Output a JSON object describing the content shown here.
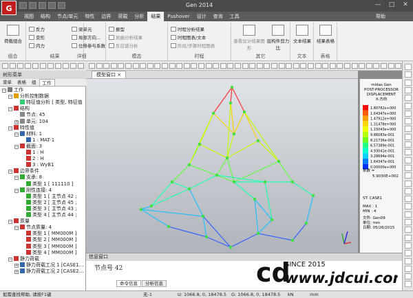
{
  "app": {
    "title": "Gen 2014",
    "logo": "Gen-logo",
    "logo_text": "G"
  },
  "window_controls": {
    "minimize": "—",
    "maximize": "□",
    "close": "✕"
  },
  "menu": {
    "tabs": [
      {
        "label": "视图"
      },
      {
        "label": "结构"
      },
      {
        "label": "节点/单元"
      },
      {
        "label": "特性"
      },
      {
        "label": "边界"
      },
      {
        "label": "荷载"
      },
      {
        "label": "分析"
      },
      {
        "label": "结果"
      },
      {
        "label": "Pushover"
      },
      {
        "label": "设计"
      },
      {
        "label": "查询"
      },
      {
        "label": "工具"
      }
    ],
    "active_index": 7,
    "help": "帮助"
  },
  "ribbon": {
    "combo": {
      "label": "荷载组合",
      "group": "组合"
    },
    "results": {
      "items": [
        "反力",
        "变形",
        "内力"
      ],
      "items2": [
        "梁单元",
        "局部方向...",
        "位移参与系数"
      ],
      "group": "结果"
    },
    "detail": {
      "items": [
        "振型",
        "屈曲分析结果",
        "反应谱分析"
      ],
      "group": "详细"
    },
    "mode": {
      "group": "模态"
    },
    "time": {
      "items": [
        "时程分析结果",
        "时程图表/文本",
        "阶段/步骤时程图表"
      ],
      "group": "时程"
    },
    "other": {
      "items": [
        "查看设计结果图形",
        "层构件剪力比"
      ],
      "group": "其它"
    },
    "text": {
      "label": "文本结果",
      "group": "文本"
    },
    "table": {
      "label": "结果表格",
      "group": "表格"
    }
  },
  "left_panel": {
    "title": "树形菜单",
    "tabs": [
      "菜单",
      "表格",
      "组",
      "工作"
    ],
    "active_tab": 3
  },
  "tree": [
    {
      "label": "工作",
      "indent": 0,
      "exp": "−",
      "color": "#777"
    },
    {
      "label": "分析控制数据",
      "indent": 1,
      "exp": "−",
      "color": "#e0a000"
    },
    {
      "label": "特征值分析 [ 类型, 特征值",
      "indent": 2,
      "exp": "",
      "color": "#3c7"
    },
    {
      "label": "结构",
      "indent": 1,
      "exp": "−",
      "color": "#c33"
    },
    {
      "label": "节点: 45",
      "indent": 2,
      "exp": "",
      "color": "#888"
    },
    {
      "label": "单元: 104",
      "indent": 2,
      "exp": "+",
      "color": "#888"
    },
    {
      "label": "特性值",
      "indent": 1,
      "exp": "−",
      "color": "#c33"
    },
    {
      "label": "材料: 1",
      "indent": 2,
      "exp": "−",
      "color": "#36a"
    },
    {
      "label": "1 : MAT-1",
      "indent": 3,
      "exp": "",
      "color": "#36a"
    },
    {
      "label": "截面: 3",
      "indent": 2,
      "exp": "−",
      "color": "#c33"
    },
    {
      "label": "1 : H",
      "indent": 3,
      "exp": "",
      "color": "#c33"
    },
    {
      "label": "2 : H",
      "indent": 3,
      "exp": "",
      "color": "#c33"
    },
    {
      "label": "3 : WyB1",
      "indent": 3,
      "exp": "",
      "color": "#c33"
    },
    {
      "label": "边界条件",
      "indent": 1,
      "exp": "−",
      "color": "#c33"
    },
    {
      "label": "支承: 8",
      "indent": 2,
      "exp": "−",
      "color": "#3a3"
    },
    {
      "label": "类型 1 [ 111110 ]",
      "indent": 3,
      "exp": "",
      "color": "#3a3"
    },
    {
      "label": "刚性连接: 4",
      "indent": 2,
      "exp": "−",
      "color": "#3a3"
    },
    {
      "label": "类型 1 [ 主节点 42 ;",
      "indent": 3,
      "exp": "",
      "color": "#3a3"
    },
    {
      "label": "类型 2 [ 主节点 45 ;",
      "indent": 3,
      "exp": "",
      "color": "#3a3"
    },
    {
      "label": "类型 3 [ 主节点 43 ;",
      "indent": 3,
      "exp": "",
      "color": "#3a3"
    },
    {
      "label": "类型 4 [ 主节点 44 ;",
      "indent": 3,
      "exp": "",
      "color": "#3a3"
    },
    {
      "label": "质量",
      "indent": 1,
      "exp": "−",
      "color": "#c33"
    },
    {
      "label": "节点质量: 4",
      "indent": 2,
      "exp": "−",
      "color": "#c33"
    },
    {
      "label": "类型 1 [ MM000M ]",
      "indent": 3,
      "exp": "",
      "color": "#c33"
    },
    {
      "label": "类型 2 [ MM000M ]",
      "indent": 3,
      "exp": "",
      "color": "#c33"
    },
    {
      "label": "类型 3 [ MM000M ]",
      "indent": 3,
      "exp": "",
      "color": "#c33"
    },
    {
      "label": "类型 4 [ MM000M ]",
      "indent": 3,
      "exp": "",
      "color": "#c33"
    },
    {
      "label": "静力荷载",
      "indent": 1,
      "exp": "−",
      "color": "#c33"
    },
    {
      "label": "静力荷载工况 1 [CASE1...",
      "indent": 2,
      "exp": "+",
      "color": "#36a"
    },
    {
      "label": "静力荷载工况 2 [CASE2...",
      "indent": 2,
      "exp": "+",
      "color": "#36a"
    }
  ],
  "view": {
    "tab_label": "模型窗口"
  },
  "legend": {
    "header1": "midas Gen",
    "header2": "POST-PROCESSOR",
    "header3": "DISPLACEMENT",
    "comp": "X-方向",
    "values": [
      "1.80782e+000",
      "1.64347e+000",
      "1.47912e+000",
      "1.31478e+000",
      "1.15043e+000",
      "9.86083e-001",
      "8.21736e-001",
      "6.57389e-001",
      "4.93041e-001",
      "3.28694e-001",
      "1.64347e-001",
      "0.00000e+000"
    ],
    "colors": [
      "#ff0000",
      "#ff5a00",
      "#ffa000",
      "#ffd800",
      "#f0ff00",
      "#b8ff00",
      "#70ff20",
      "#20ff80",
      "#00ffd0",
      "#00d0ff",
      "#0080ff",
      "#0030ff"
    ],
    "coef_label": "系数 =",
    "coef": "5.9030E+002",
    "st": "ST: CASE1",
    "max": "MAX : 1",
    "min": "MIN : 4",
    "file": "文件: Gen09",
    "unit": "单位: mm",
    "date": "日期: 05/26/2015"
  },
  "messages": {
    "title": "信息窗口",
    "command": "节点号 42",
    "tabs": [
      "命令信息",
      "分析信息"
    ]
  },
  "status": {
    "help": "如需查找帮助, 请按F1键",
    "none": "无-1",
    "u": "U: 1066.8, 0, 18478.5",
    "g": "G: 1066.8, 0, 18478.5",
    "unit_kn": "kN",
    "unit_mm": "mm"
  },
  "watermark": {
    "since": "SINCE 2015",
    "url": "www.jdcui.com",
    "logo": "cd-logo",
    "logo_text": "cd"
  }
}
